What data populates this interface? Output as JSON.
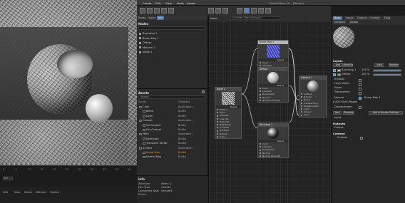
{
  "topbar": {
    "menus": [
      "Create",
      "Edit",
      "View",
      "Node",
      "Assets"
    ],
    "title": "Node Editor (1) - [Nodes]"
  },
  "viewport": {
    "ticks": [
      "0",
      "5",
      "10",
      "15",
      "20",
      "25",
      "30",
      "35",
      "40",
      "45",
      "50"
    ],
    "frame": "0 F"
  },
  "matbar": {
    "menus": [
      "Edit",
      "View",
      "Select",
      "Material",
      "Texture"
    ]
  },
  "nodes_panel": {
    "tabs": [
      "Nodes",
      "Scene",
      "Info"
    ],
    "title": "Nodes",
    "search_placeholder": "",
    "items": [
      "Backdrop 1",
      "Bump Map 1",
      "Diffuse",
      "Material 1",
      "Noise 1"
    ]
  },
  "assets_panel": {
    "title": "Assets",
    "search": "Normal",
    "col_name": "Assets",
    "col_db": "Database",
    "rows": [
      {
        "name": "Color",
        "db": "Application",
        "indent": 1,
        "check": false,
        "orange": false
      },
      {
        "name": "Blend",
        "db": "Builtin",
        "indent": 2,
        "check": false,
        "orange": false
      },
      {
        "name": "Layer",
        "db": "Builtin",
        "indent": 2,
        "check": false,
        "orange": false
      },
      {
        "name": "Context",
        "db": "Application",
        "indent": 1,
        "check": false,
        "orange": false
      },
      {
        "name": "Set Context",
        "db": "Builtin",
        "indent": 2,
        "check": false,
        "orange": false
      },
      {
        "name": "Get Context",
        "db": "Builtin",
        "indent": 2,
        "check": false,
        "orange": false
      },
      {
        "name": "Math",
        "db": "Application",
        "indent": 1,
        "check": false,
        "orange": false
      },
      {
        "name": "Normalize",
        "db": "Builtin",
        "indent": 2,
        "check": false,
        "orange": false
      },
      {
        "name": "Transform Vector",
        "db": "Builtin",
        "indent": 2,
        "check": false,
        "orange": false
      },
      {
        "name": "Surface",
        "db": "Application",
        "indent": 1,
        "check": false,
        "orange": false
      },
      {
        "name": "Bump Map",
        "db": "Builtin",
        "indent": 2,
        "check": false,
        "orange": true
      },
      {
        "name": "Normal Map",
        "db": "Builtin",
        "indent": 2,
        "check": false,
        "orange": false
      }
    ]
  },
  "info_panel": {
    "title": "Info",
    "lines": [
      {
        "k": "Selection:",
        "v": "Wires: 1"
      },
      {
        "k": "Port Type:",
        "v": "Color64"
      },
      {
        "k": "Connected Type:",
        "v": "Vector64"
      },
      {
        "k": "Errors:",
        "v": ""
      }
    ]
  },
  "editor": {
    "tab": "Node",
    "search": "<<Enter Filter String>>",
    "nodes": {
      "bump": {
        "title": "Bump Map 1",
        "sub": "Result",
        "ports": [
          "Input",
          "Strength",
          "Normal",
          "UV Scaler",
          "Bump Map"
        ]
      },
      "noise": {
        "title": "Noise 1",
        "sub": "Result",
        "ports": [
          "Pattern",
          "Seed",
          "Octaves",
          "Low Clip",
          "High Clip",
          "Brightness",
          "Contrast",
          "Gradient",
          "Output",
          "Color"
        ]
      },
      "diffuse": {
        "title": "Diffuse",
        "sub": "Result",
        "ports": [
          "Color",
          "Intensity",
          "Roughness",
          "Normal",
          "Normal Strength"
        ]
      },
      "backdrop": {
        "title": "Backdrop 1",
        "sub": "Result",
        "ports": [
          "Color",
          "Intensity",
          "Roughness",
          "Normal",
          "Normal Strength"
        ]
      },
      "material": {
        "title": "Material 1",
        "sub": "",
        "ports": [
          "Surface",
          "Normal",
          "Bump",
          "Transparency",
          "Displacement",
          "Input",
          "Output",
          "Color"
        ]
      }
    }
  },
  "attributes": {
    "tabs": [
      "Basic",
      "Inputs",
      "Outputs",
      "Context",
      "Data"
    ],
    "tabs2": [
      "Viewport",
      "Assign"
    ],
    "inputs_title": "Inputs",
    "buttons": [
      "Add",
      "Remove",
      "View",
      "Rename"
    ],
    "rows": [
      {
        "label": "Backdrop 1",
        "checked": true,
        "value": "100 %",
        "swatch": "#c8c8c8"
      },
      {
        "label": "Diffuse",
        "checked": true,
        "value": "100 %",
        "swatch": "#9a9a9a"
      }
    ],
    "emboss": "Emboss",
    "layer_alpha": "Layer Alpha",
    "alpha": "Alpha",
    "transparent": "Transparent",
    "normal": "Normal",
    "bump_map": "Bump Map 1",
    "aov": "▸ AOV Multi-Passes",
    "displacement": "Displacement",
    "add_btn": "Add",
    "remove_btn": "Remove",
    "add_render": "Add to Render Settings",
    "input_label": "Input",
    "outputs_title": "Outputs",
    "output_label": "Output",
    "context_title": "Context",
    "context_label": "Context"
  }
}
